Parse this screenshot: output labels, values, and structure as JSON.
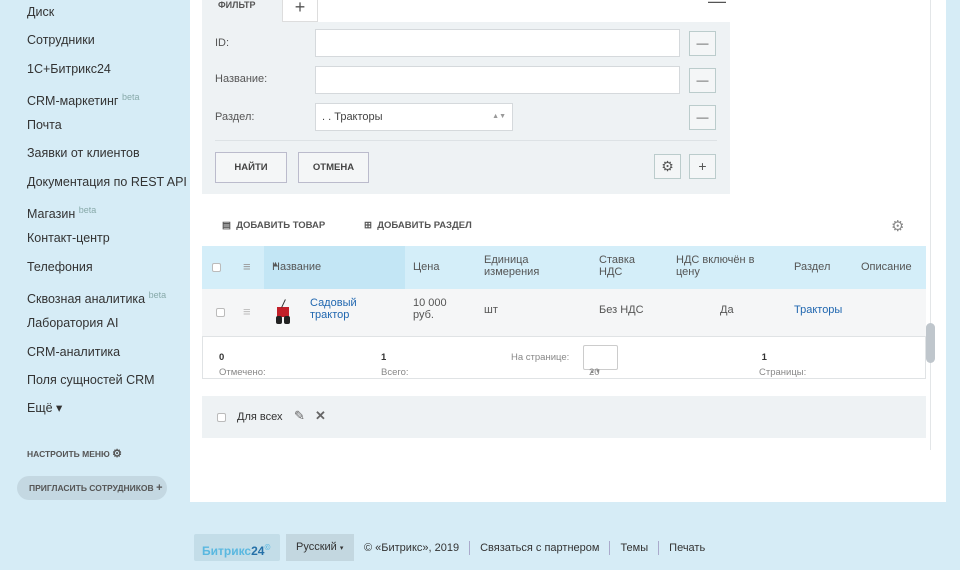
{
  "sidebar": {
    "items": [
      "Диск",
      "Сотрудники",
      "1С+Битрикс24",
      "CRM-маркетинг",
      "Почта",
      "Заявки от клиентов",
      "Документация по REST API",
      "Магазин",
      "Контакт-центр",
      "Телефония",
      "Сквозная аналитика",
      "Лаборатория AI",
      "CRM-аналитика",
      "Поля сущностей CRM",
      "Ещё ▾"
    ],
    "beta": "beta",
    "configure": "НАСТРОИТЬ МЕНЮ",
    "invite": "ПРИГЛАСИТЬ СОТРУДНИКОВ"
  },
  "filter": {
    "tab": "ФИЛЬТР",
    "id_label": "ID:",
    "id_value": "",
    "name_label": "Название:",
    "name_value": "",
    "section_label": "Раздел:",
    "section_value": ". . Тракторы",
    "find": "НАЙТИ",
    "cancel": "ОТМЕНА"
  },
  "actions": {
    "add_product": "ДОБАВИТЬ ТОВАР",
    "add_section": "ДОБАВИТЬ РАЗДЕЛ"
  },
  "grid": {
    "columns": [
      "Название",
      "Цена",
      "Единица измерения",
      "Ставка НДС",
      "НДС включён в цену",
      "Раздел",
      "Описание"
    ],
    "rows": [
      {
        "name": "Садовый трактор",
        "price": "10 000 руб.",
        "unit": "шт",
        "vat": "Без НДС",
        "vat_included": "Да",
        "section": "Тракторы",
        "description": ""
      }
    ],
    "footer": {
      "selected_label": "Отмечено:",
      "selected": "0",
      "total_label": "Всего:",
      "total": "1",
      "per_page_label": "На странице:",
      "per_page": "20",
      "pages_label": "Страницы:",
      "pages": "1"
    },
    "for_all": "Для всех"
  },
  "footer": {
    "logo": "Битрикс24",
    "language": "Русский",
    "copyright": "© «Битрикс», 2019",
    "partner": "Связаться с партнером",
    "themes": "Темы",
    "print": "Печать"
  }
}
